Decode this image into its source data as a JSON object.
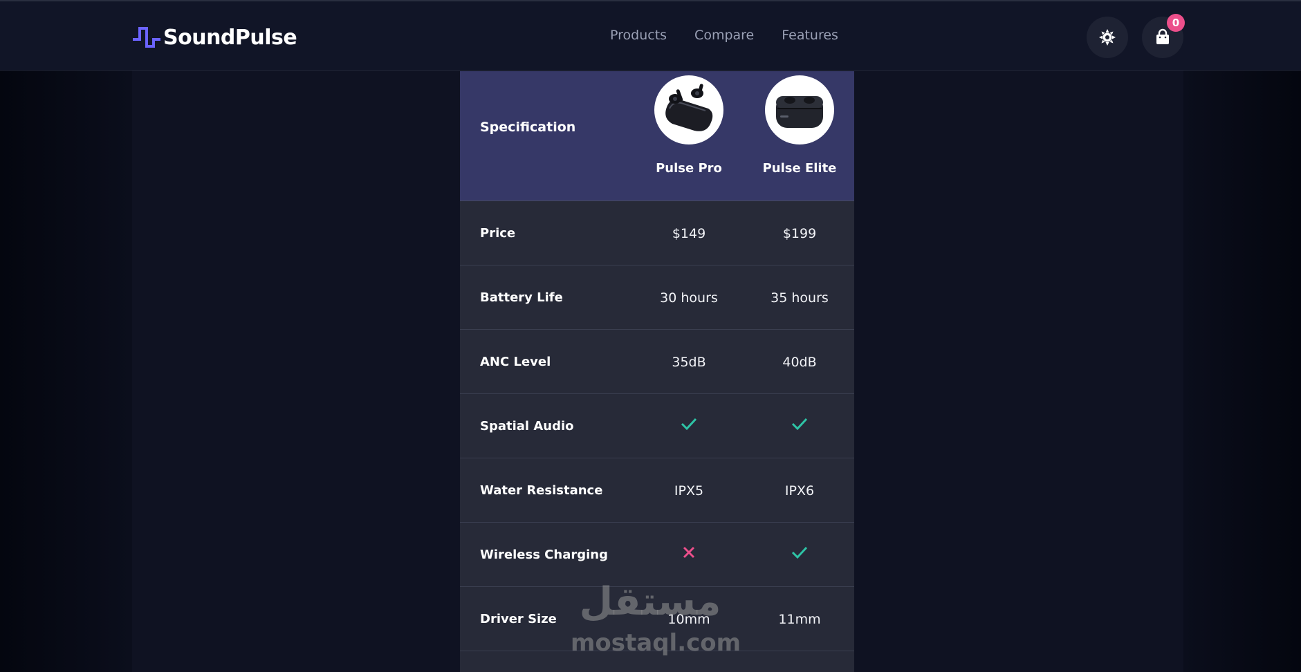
{
  "brand": {
    "name": "SoundPulse",
    "accent": "#6b63ff"
  },
  "nav": {
    "links": [
      "Products",
      "Compare",
      "Features"
    ]
  },
  "header_actions": {
    "cart_count": "0",
    "badge_color": "#ec4f8b"
  },
  "table": {
    "spec_header": "Specification",
    "products": [
      {
        "name": "Pulse Pro",
        "image": "earbuds-open-case"
      },
      {
        "name": "Pulse Elite",
        "image": "earbuds-closed-case"
      }
    ],
    "rows": [
      {
        "label": "Price",
        "values": [
          "$149",
          "$199"
        ]
      },
      {
        "label": "Battery Life",
        "values": [
          "30 hours",
          "35 hours"
        ]
      },
      {
        "label": "ANC Level",
        "values": [
          "35dB",
          "40dB"
        ]
      },
      {
        "label": "Spatial Audio",
        "values": [
          "check",
          "check"
        ]
      },
      {
        "label": "Water Resistance",
        "values": [
          "IPX5",
          "IPX6"
        ]
      },
      {
        "label": "Wireless Charging",
        "values": [
          "cross",
          "check"
        ]
      },
      {
        "label": "Driver Size",
        "values": [
          "10mm",
          "11mm"
        ]
      }
    ],
    "colors": {
      "header_bg": "#363867",
      "row_bg": "#272a38",
      "check": "#2ec4a6",
      "cross": "#ec4f8b"
    }
  },
  "watermark": {
    "arabic": "مستقل",
    "latin": "mostaql.com"
  }
}
